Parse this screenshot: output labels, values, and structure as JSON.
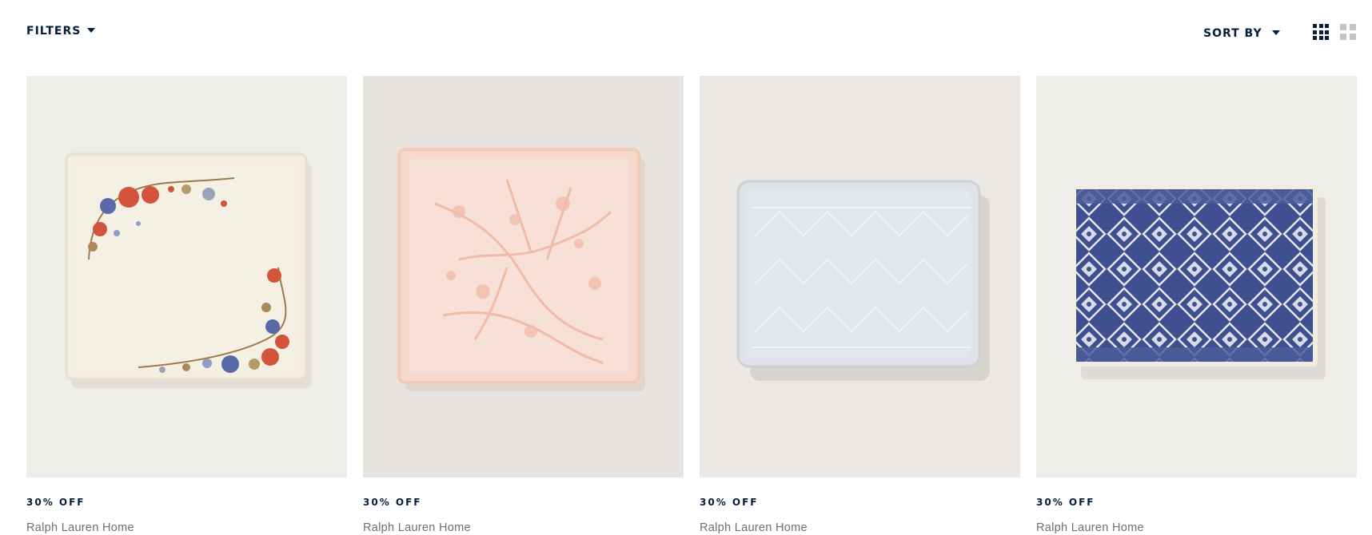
{
  "toolbar": {
    "filters_label": "FILTERS",
    "sort_label": "SORT BY"
  },
  "products": [
    {
      "promo": "30% OFF",
      "brand": "Ralph Lauren Home"
    },
    {
      "promo": "30% OFF",
      "brand": "Ralph Lauren Home"
    },
    {
      "promo": "30% OFF",
      "brand": "Ralph Lauren Home"
    },
    {
      "promo": "30% OFF",
      "brand": "Ralph Lauren Home"
    }
  ],
  "colors": {
    "navy": "#041e3a",
    "muted_text": "#6f6f6f",
    "inactive_icon": "#c4c4c4"
  }
}
